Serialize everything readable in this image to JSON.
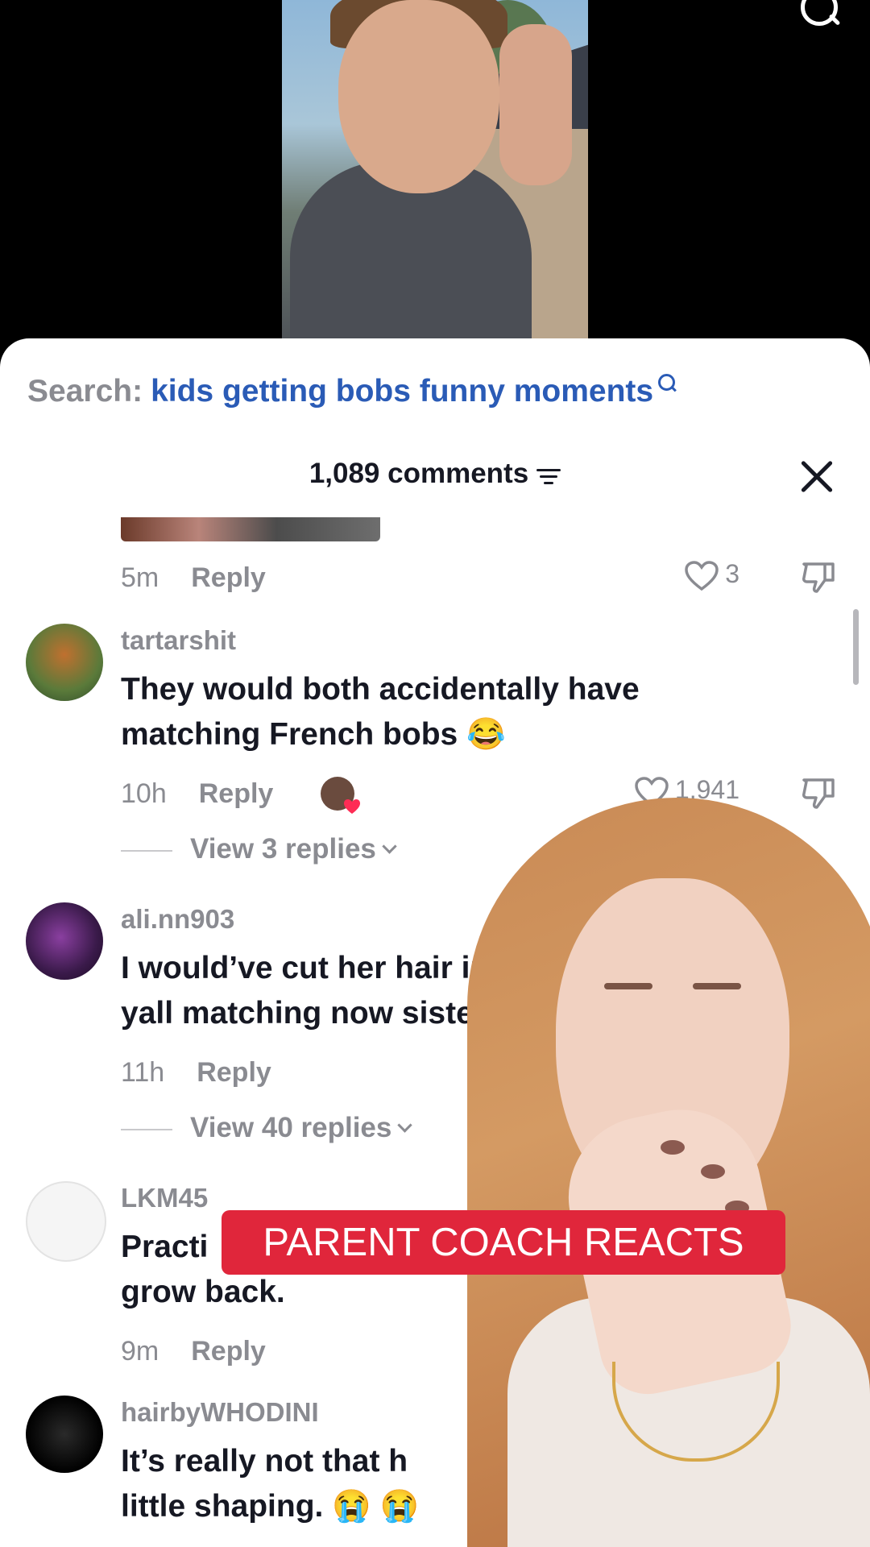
{
  "search": {
    "prefix": "Search:",
    "query": "kids getting bobs funny moments"
  },
  "comments_header": {
    "count_label": "1,089 comments"
  },
  "top_meta": {
    "time": "5m",
    "reply": "Reply",
    "likes": "3"
  },
  "comments": [
    {
      "username": "tartarshit",
      "text": "They would both accidentally have matching French bobs 😂",
      "time": "10h",
      "reply": "Reply",
      "likes": "1,941",
      "view_replies": "View 3 replies"
    },
    {
      "username": "ali.nn903",
      "text": "I would’ve cut her hair int",
      "text2": "yall matching now sister",
      "time": "11h",
      "reply": "Reply",
      "view_replies": "View 40 replies"
    },
    {
      "username": "LKM45",
      "text": "Practi",
      "text2": "grow back.",
      "time": "9m",
      "reply": "Reply"
    },
    {
      "username": "hairbyWHODINI",
      "text": "It’s really not that h",
      "text2": "little shaping. 😭 😭"
    }
  ],
  "overlay": {
    "banner": "PARENT COACH REACTS"
  },
  "colors": {
    "accent_blue": "#2a5bb6",
    "banner_red": "#e0263b",
    "muted_text": "#8a8b91",
    "primary_text": "#161823"
  }
}
